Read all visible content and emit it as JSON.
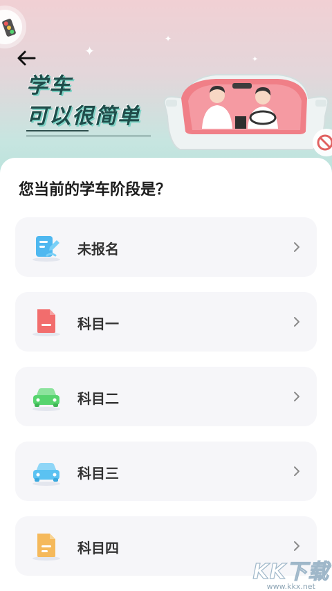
{
  "header": {
    "title_line1": "学车",
    "title_line2": "可以很简单",
    "back_icon": "arrow-left-icon"
  },
  "question": "您当前的学车阶段是？",
  "options": [
    {
      "label": "未报名",
      "icon": "signup-form-icon",
      "color": "#4fb8f0"
    },
    {
      "label": "科目一",
      "icon": "document-icon",
      "color": "#f26d6d"
    },
    {
      "label": "科目二",
      "icon": "car-icon",
      "color": "#56d46e"
    },
    {
      "label": "科目三",
      "icon": "car-icon",
      "color": "#5bc2f2"
    },
    {
      "label": "科目四",
      "icon": "document-icon",
      "color": "#f5b95b"
    }
  ],
  "watermark": {
    "main": "KK下载",
    "sub": "www.kkx.net"
  },
  "colors": {
    "option_bg": "#f6f6f9",
    "title_text": "#1f4d4a",
    "hero_top": "#f1d0d4",
    "hero_bottom": "#b8e3dc"
  }
}
